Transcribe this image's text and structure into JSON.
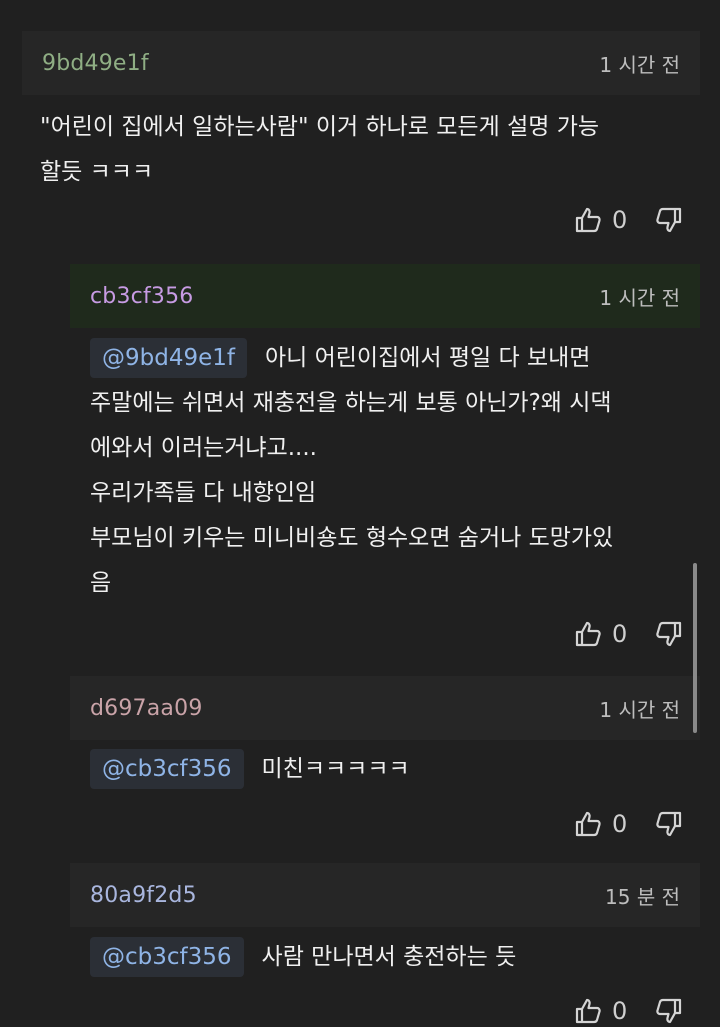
{
  "comments": [
    {
      "author": "9bd49e1f",
      "time": "1 시간 전",
      "text_lines": [
        "\"어린이 집에서 일하는사람\" 이거 하나로 모든게 설명 가능",
        "할듯 ㅋㅋㅋ"
      ],
      "likes": "0"
    },
    {
      "author": "cb3cf356",
      "time": "1 시간 전",
      "mention": "@9bd49e1f",
      "text_lines": [
        "아니 어린이집에서 평일 다 보내면",
        "주말에는 쉬면서 재충전을 하는게 보통 아닌가?왜 시댁",
        "에와서 이러는거냐고....",
        "우리가족들 다 내향인임",
        "부모님이 키우는 미니비숑도 형수오면 숨거나 도망가있",
        "음"
      ],
      "likes": "0"
    },
    {
      "author": "d697aa09",
      "time": "1 시간 전",
      "mention": "@cb3cf356",
      "text_lines": [
        "미친ㅋㅋㅋㅋㅋ"
      ],
      "likes": "0"
    },
    {
      "author": "80a9f2d5",
      "time": "15 분 전",
      "mention": "@cb3cf356",
      "text_lines": [
        "사람 만나면서 충전하는 듯"
      ],
      "likes": "0"
    }
  ],
  "colors": {
    "background": "#202020",
    "header_default": "#262626",
    "header_highlight": "#1f2a1c",
    "author_1": "#8fae84",
    "author_2": "#c79be3",
    "author_3": "#c9a3a8",
    "author_4": "#a9b6de",
    "mention": "#8fb4e6"
  },
  "icons": [
    "thumbs-up-icon",
    "thumbs-down-icon"
  ]
}
